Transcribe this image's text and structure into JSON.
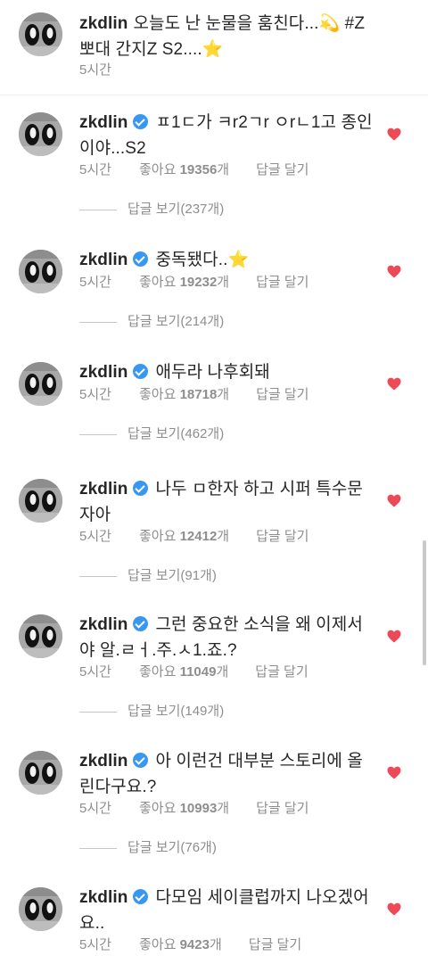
{
  "caption": {
    "username": "zkdlin",
    "text": "오늘도 난 눈물을 훔친다...💫 #Z뽀대 간지Z S2....⭐",
    "time": "5시간"
  },
  "comments": [
    {
      "username": "zkdlin",
      "text": "ㅍ1ㄷ가 ㅋr2ㄱr ㅇrㄴ1고 종인이야...S2",
      "time": "5시간",
      "likes_label": "좋아요",
      "likes_count": "19356",
      "likes_unit": "개",
      "reply_label": "답글 달기",
      "view_replies": "답글 보기(237개)"
    },
    {
      "username": "zkdlin",
      "text": "중독됐다..⭐",
      "time": "5시간",
      "likes_label": "좋아요",
      "likes_count": "19232",
      "likes_unit": "개",
      "reply_label": "답글 달기",
      "view_replies": "답글 보기(214개)"
    },
    {
      "username": "zkdlin",
      "text": "애두라 나후회돼",
      "time": "5시간",
      "likes_label": "좋아요",
      "likes_count": "18718",
      "likes_unit": "개",
      "reply_label": "답글 달기",
      "view_replies": "답글 보기(462개)"
    },
    {
      "username": "zkdlin",
      "text": "나두 ㅁ한자 하고 시퍼 특수문자아",
      "time": "5시간",
      "likes_label": "좋아요",
      "likes_count": "12412",
      "likes_unit": "개",
      "reply_label": "답글 달기",
      "view_replies": "답글 보기(91개)"
    },
    {
      "username": "zkdlin",
      "text": "그런 중요한 소식을 왜 이제서야 알.ㄹㅓ.주.ㅅ1.죠.?",
      "time": "5시간",
      "likes_label": "좋아요",
      "likes_count": "11049",
      "likes_unit": "개",
      "reply_label": "답글 달기",
      "view_replies": "답글 보기(149개)"
    },
    {
      "username": "zkdlin",
      "text": "아 이런건 대부분 스토리에 올린다구요.?",
      "time": "5시간",
      "likes_label": "좋아요",
      "likes_count": "10993",
      "likes_unit": "개",
      "reply_label": "답글 달기",
      "view_replies": "답글 보기(76개)"
    },
    {
      "username": "zkdlin",
      "text": "다모임 세이클럽까지 나오겠어요..",
      "time": "5시간",
      "likes_label": "좋아요",
      "likes_count": "9423",
      "likes_unit": "개",
      "reply_label": "답글 달기"
    }
  ],
  "colors": {
    "heart": "#ed4956",
    "verified": "#3897f0",
    "meta_text": "#8e8e8e",
    "text": "#262626"
  },
  "icons": {
    "heart": "heart-icon",
    "verified": "verified-badge-icon",
    "avatar": "avatar"
  }
}
